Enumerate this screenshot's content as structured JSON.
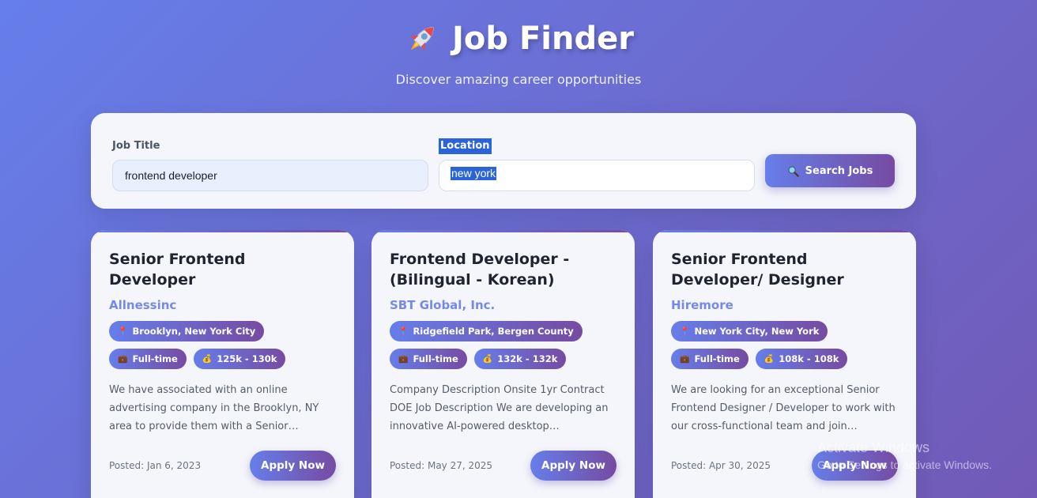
{
  "header": {
    "title": "Job Finder",
    "subtitle": "Discover amazing career opportunities"
  },
  "search": {
    "job_title_label": "Job Title",
    "job_title_value": "frontend developer",
    "location_label": "Location",
    "location_value": "new york",
    "button_label": "Search Jobs"
  },
  "jobs": [
    {
      "title": "Senior Frontend Developer",
      "company": "Allnessinc",
      "location": "Brooklyn, New York City",
      "type": "Full-time",
      "salary": "125k - 130k",
      "description": "We have associated with an online advertising company in the Brooklyn, NY area to provide them with a Senior Frontend Developer...",
      "posted": "Posted: Jan 6, 2023",
      "apply_label": "Apply Now"
    },
    {
      "title": "Frontend Developer - (Bilingual - Korean)",
      "company": "SBT Global, Inc.",
      "location": "Ridgefield Park, Bergen County",
      "type": "Full-time",
      "salary": "132k - 132k",
      "description": "Company Description Onsite 1yr Contract DOE Job Description We are developing an innovative AI-powered desktop application...",
      "posted": "Posted: May 27, 2025",
      "apply_label": "Apply Now"
    },
    {
      "title": "Senior Frontend Developer/ Designer",
      "company": "Hiremore",
      "location": "New York City, New York",
      "type": "Full-time",
      "salary": "108k - 108k",
      "description": "We are looking for an exceptional Senior Frontend Designer / Developer to work with our cross-functional team and join ourworld...",
      "posted": "Posted: Apr 30, 2025",
      "apply_label": "Apply Now"
    }
  ],
  "watermark": {
    "title": "Activate Windows",
    "subtitle": "Go to Settings to activate Windows."
  },
  "icons": {
    "rocket": "rocket-icon",
    "search": "magnifier-icon",
    "location": "pin-icon",
    "type": "briefcase-icon",
    "salary": "money-bag-icon"
  },
  "colors": {
    "accent_start": "#667eea",
    "accent_end": "#764ba2"
  }
}
